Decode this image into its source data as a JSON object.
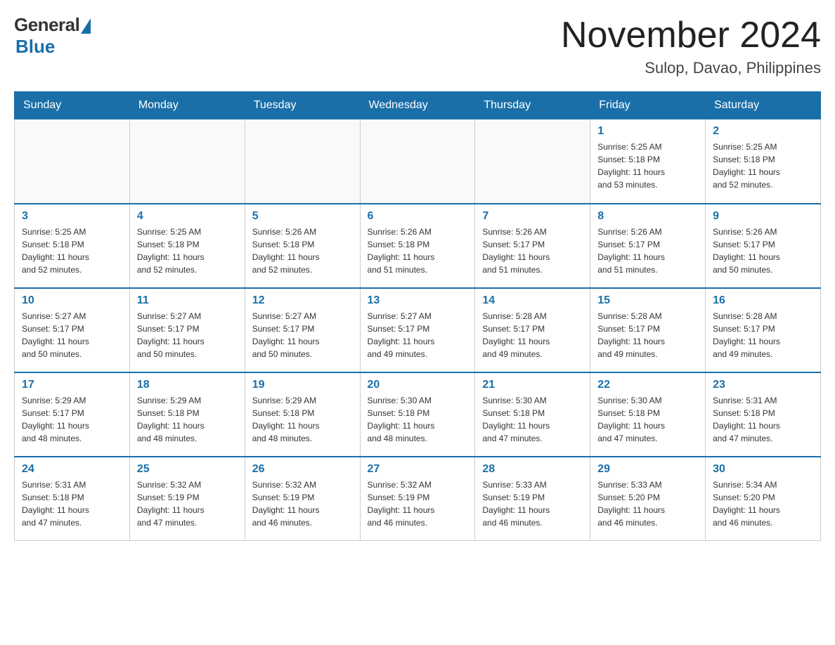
{
  "logo": {
    "general": "General",
    "blue": "Blue",
    "subtitle": "Blue"
  },
  "header": {
    "title": "November 2024",
    "location": "Sulop, Davao, Philippines"
  },
  "days_of_week": [
    "Sunday",
    "Monday",
    "Tuesday",
    "Wednesday",
    "Thursday",
    "Friday",
    "Saturday"
  ],
  "weeks": [
    [
      {
        "day": "",
        "info": ""
      },
      {
        "day": "",
        "info": ""
      },
      {
        "day": "",
        "info": ""
      },
      {
        "day": "",
        "info": ""
      },
      {
        "day": "",
        "info": ""
      },
      {
        "day": "1",
        "info": "Sunrise: 5:25 AM\nSunset: 5:18 PM\nDaylight: 11 hours\nand 53 minutes."
      },
      {
        "day": "2",
        "info": "Sunrise: 5:25 AM\nSunset: 5:18 PM\nDaylight: 11 hours\nand 52 minutes."
      }
    ],
    [
      {
        "day": "3",
        "info": "Sunrise: 5:25 AM\nSunset: 5:18 PM\nDaylight: 11 hours\nand 52 minutes."
      },
      {
        "day": "4",
        "info": "Sunrise: 5:25 AM\nSunset: 5:18 PM\nDaylight: 11 hours\nand 52 minutes."
      },
      {
        "day": "5",
        "info": "Sunrise: 5:26 AM\nSunset: 5:18 PM\nDaylight: 11 hours\nand 52 minutes."
      },
      {
        "day": "6",
        "info": "Sunrise: 5:26 AM\nSunset: 5:18 PM\nDaylight: 11 hours\nand 51 minutes."
      },
      {
        "day": "7",
        "info": "Sunrise: 5:26 AM\nSunset: 5:17 PM\nDaylight: 11 hours\nand 51 minutes."
      },
      {
        "day": "8",
        "info": "Sunrise: 5:26 AM\nSunset: 5:17 PM\nDaylight: 11 hours\nand 51 minutes."
      },
      {
        "day": "9",
        "info": "Sunrise: 5:26 AM\nSunset: 5:17 PM\nDaylight: 11 hours\nand 50 minutes."
      }
    ],
    [
      {
        "day": "10",
        "info": "Sunrise: 5:27 AM\nSunset: 5:17 PM\nDaylight: 11 hours\nand 50 minutes."
      },
      {
        "day": "11",
        "info": "Sunrise: 5:27 AM\nSunset: 5:17 PM\nDaylight: 11 hours\nand 50 minutes."
      },
      {
        "day": "12",
        "info": "Sunrise: 5:27 AM\nSunset: 5:17 PM\nDaylight: 11 hours\nand 50 minutes."
      },
      {
        "day": "13",
        "info": "Sunrise: 5:27 AM\nSunset: 5:17 PM\nDaylight: 11 hours\nand 49 minutes."
      },
      {
        "day": "14",
        "info": "Sunrise: 5:28 AM\nSunset: 5:17 PM\nDaylight: 11 hours\nand 49 minutes."
      },
      {
        "day": "15",
        "info": "Sunrise: 5:28 AM\nSunset: 5:17 PM\nDaylight: 11 hours\nand 49 minutes."
      },
      {
        "day": "16",
        "info": "Sunrise: 5:28 AM\nSunset: 5:17 PM\nDaylight: 11 hours\nand 49 minutes."
      }
    ],
    [
      {
        "day": "17",
        "info": "Sunrise: 5:29 AM\nSunset: 5:17 PM\nDaylight: 11 hours\nand 48 minutes."
      },
      {
        "day": "18",
        "info": "Sunrise: 5:29 AM\nSunset: 5:18 PM\nDaylight: 11 hours\nand 48 minutes."
      },
      {
        "day": "19",
        "info": "Sunrise: 5:29 AM\nSunset: 5:18 PM\nDaylight: 11 hours\nand 48 minutes."
      },
      {
        "day": "20",
        "info": "Sunrise: 5:30 AM\nSunset: 5:18 PM\nDaylight: 11 hours\nand 48 minutes."
      },
      {
        "day": "21",
        "info": "Sunrise: 5:30 AM\nSunset: 5:18 PM\nDaylight: 11 hours\nand 47 minutes."
      },
      {
        "day": "22",
        "info": "Sunrise: 5:30 AM\nSunset: 5:18 PM\nDaylight: 11 hours\nand 47 minutes."
      },
      {
        "day": "23",
        "info": "Sunrise: 5:31 AM\nSunset: 5:18 PM\nDaylight: 11 hours\nand 47 minutes."
      }
    ],
    [
      {
        "day": "24",
        "info": "Sunrise: 5:31 AM\nSunset: 5:18 PM\nDaylight: 11 hours\nand 47 minutes."
      },
      {
        "day": "25",
        "info": "Sunrise: 5:32 AM\nSunset: 5:19 PM\nDaylight: 11 hours\nand 47 minutes."
      },
      {
        "day": "26",
        "info": "Sunrise: 5:32 AM\nSunset: 5:19 PM\nDaylight: 11 hours\nand 46 minutes."
      },
      {
        "day": "27",
        "info": "Sunrise: 5:32 AM\nSunset: 5:19 PM\nDaylight: 11 hours\nand 46 minutes."
      },
      {
        "day": "28",
        "info": "Sunrise: 5:33 AM\nSunset: 5:19 PM\nDaylight: 11 hours\nand 46 minutes."
      },
      {
        "day": "29",
        "info": "Sunrise: 5:33 AM\nSunset: 5:20 PM\nDaylight: 11 hours\nand 46 minutes."
      },
      {
        "day": "30",
        "info": "Sunrise: 5:34 AM\nSunset: 5:20 PM\nDaylight: 11 hours\nand 46 minutes."
      }
    ]
  ]
}
